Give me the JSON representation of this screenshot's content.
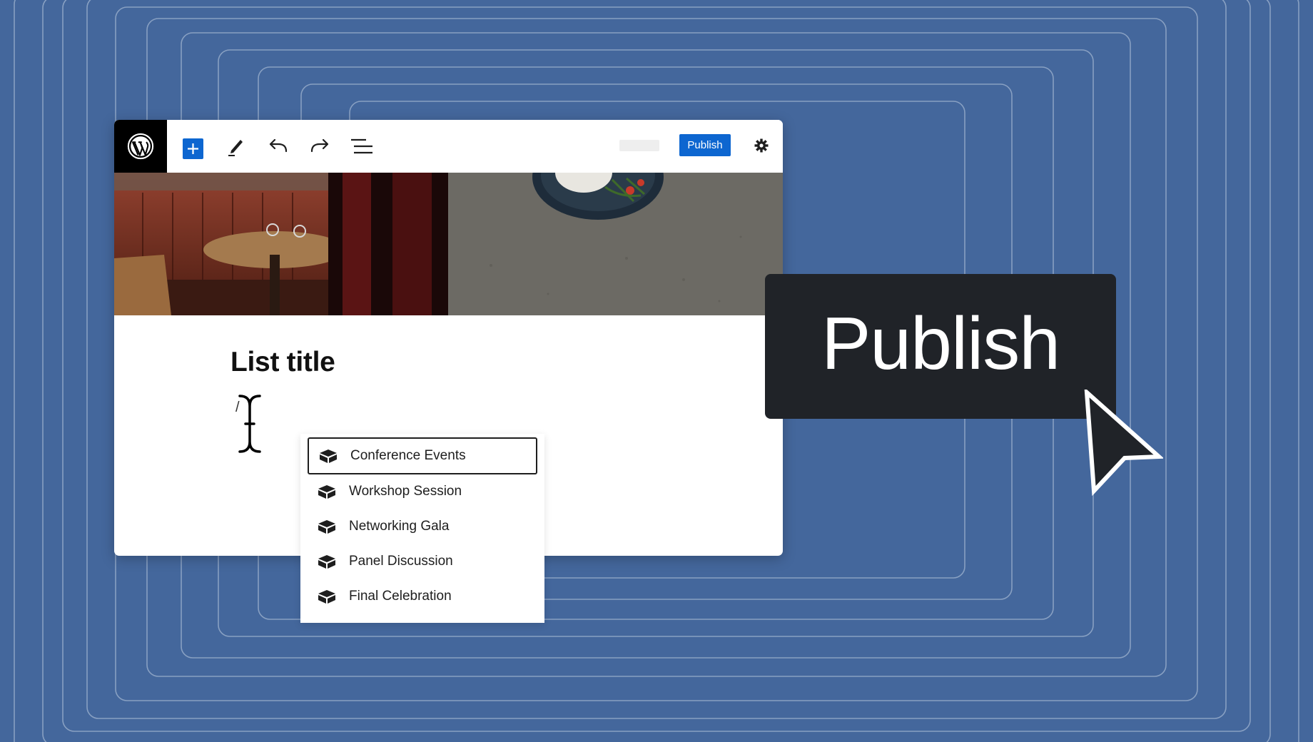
{
  "toolbar": {
    "publish_label": "Publish"
  },
  "editor": {
    "list_title": "List title",
    "slash_command": "/"
  },
  "dropdown": {
    "items": [
      {
        "label": "Conference Events",
        "icon": "cube-icon",
        "selected": true
      },
      {
        "label": "Workshop Session",
        "icon": "cube-icon",
        "selected": false
      },
      {
        "label": "Networking Gala",
        "icon": "cube-icon",
        "selected": false
      },
      {
        "label": "Panel Discussion",
        "icon": "cube-icon",
        "selected": false
      },
      {
        "label": "Final Celebration",
        "icon": "cube-icon",
        "selected": false
      }
    ]
  },
  "callout": {
    "publish_label": "Publish"
  },
  "colors": {
    "background": "#44679c",
    "accent": "#0d66d0",
    "callout": "#202328"
  }
}
